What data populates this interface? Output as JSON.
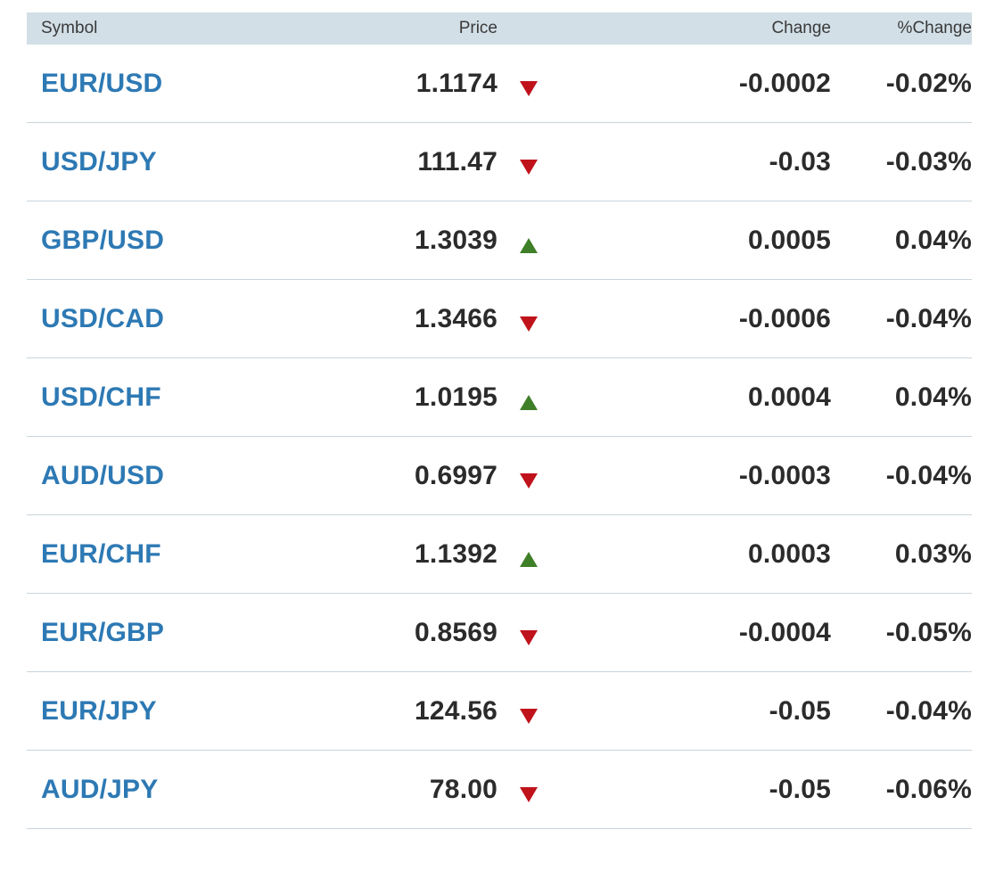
{
  "table": {
    "headers": {
      "symbol": "Symbol",
      "price": "Price",
      "change": "Change",
      "pct_change": "%Change"
    },
    "colors": {
      "header_bg": "#d2dfe6",
      "symbol_link": "#2d79b4",
      "down": "#c0121b",
      "up": "#3f7f28",
      "row_border": "#c9d5dc"
    },
    "rows": [
      {
        "symbol": "EUR/USD",
        "price": "1.1174",
        "direction": "down",
        "change": "-0.0002",
        "pct_change": "-0.02%"
      },
      {
        "symbol": "USD/JPY",
        "price": "111.47",
        "direction": "down",
        "change": "-0.03",
        "pct_change": "-0.03%"
      },
      {
        "symbol": "GBP/USD",
        "price": "1.3039",
        "direction": "up",
        "change": "0.0005",
        "pct_change": "0.04%"
      },
      {
        "symbol": "USD/CAD",
        "price": "1.3466",
        "direction": "down",
        "change": "-0.0006",
        "pct_change": "-0.04%"
      },
      {
        "symbol": "USD/CHF",
        "price": "1.0195",
        "direction": "up",
        "change": "0.0004",
        "pct_change": "0.04%"
      },
      {
        "symbol": "AUD/USD",
        "price": "0.6997",
        "direction": "down",
        "change": "-0.0003",
        "pct_change": "-0.04%"
      },
      {
        "symbol": "EUR/CHF",
        "price": "1.1392",
        "direction": "up",
        "change": "0.0003",
        "pct_change": "0.03%"
      },
      {
        "symbol": "EUR/GBP",
        "price": "0.8569",
        "direction": "down",
        "change": "-0.0004",
        "pct_change": "-0.05%"
      },
      {
        "symbol": "EUR/JPY",
        "price": "124.56",
        "direction": "down",
        "change": "-0.05",
        "pct_change": "-0.04%"
      },
      {
        "symbol": "AUD/JPY",
        "price": "78.00",
        "direction": "down",
        "change": "-0.05",
        "pct_change": "-0.06%"
      }
    ]
  }
}
